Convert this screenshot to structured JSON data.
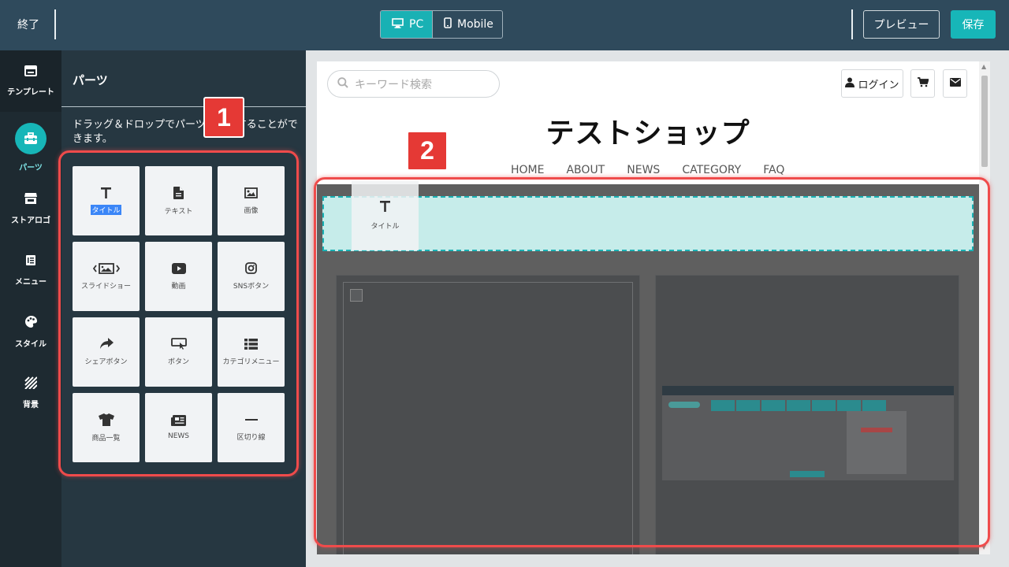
{
  "topbar": {
    "exit_label": "終了",
    "devices": [
      {
        "label": "PC",
        "active": true,
        "icon": "monitor-icon"
      },
      {
        "label": "Mobile",
        "active": false,
        "icon": "mobile-phone-icon"
      }
    ],
    "preview_label": "プレビュー",
    "save_label": "保存"
  },
  "leftnav": {
    "items": [
      {
        "label": "テンプレート",
        "icon": "template-icon"
      },
      {
        "label": "パーツ",
        "icon": "toolbox-icon",
        "selected": true
      },
      {
        "label": "ストアロゴ",
        "icon": "store-icon"
      },
      {
        "label": "メニュー",
        "icon": "menu-list-icon"
      },
      {
        "label": "スタイル",
        "icon": "palette-icon"
      },
      {
        "label": "背景",
        "icon": "stripes-icon"
      }
    ]
  },
  "panel": {
    "title": "パーツ",
    "description": "ドラッグ＆ドロップでパーツを追加することができます。",
    "parts": [
      {
        "label": "タイトル",
        "icon": "title-t-icon",
        "selected": true
      },
      {
        "label": "テキスト",
        "icon": "document-icon"
      },
      {
        "label": "画像",
        "icon": "image-icon"
      },
      {
        "label": "スライドショー",
        "icon": "slideshow-icon"
      },
      {
        "label": "動画",
        "icon": "video-play-icon"
      },
      {
        "label": "SNSボタン",
        "icon": "instagram-icon"
      },
      {
        "label": "シェアボタン",
        "icon": "share-arrow-icon"
      },
      {
        "label": "ボタン",
        "icon": "button-click-icon"
      },
      {
        "label": "カテゴリメニュー",
        "icon": "category-list-icon"
      },
      {
        "label": "商品一覧",
        "icon": "tshirt-icon"
      },
      {
        "label": "NEWS",
        "icon": "news-icon"
      },
      {
        "label": "区切り線",
        "icon": "divider-line-icon"
      }
    ]
  },
  "annotations": {
    "badge1": "1",
    "badge2": "2"
  },
  "site": {
    "search_placeholder": "キーワード検索",
    "login_label": "ログイン",
    "shop_title": "テストショップ",
    "nav": [
      "HOME",
      "ABOUT",
      "NEWS",
      "CATEGORY",
      "FAQ"
    ],
    "dragging_part_label": "タイトル"
  },
  "colors": {
    "accent": "#19b1b4",
    "topbar": "#2f4a5c",
    "panel": "#263741",
    "annotation_red": "#e53935"
  }
}
